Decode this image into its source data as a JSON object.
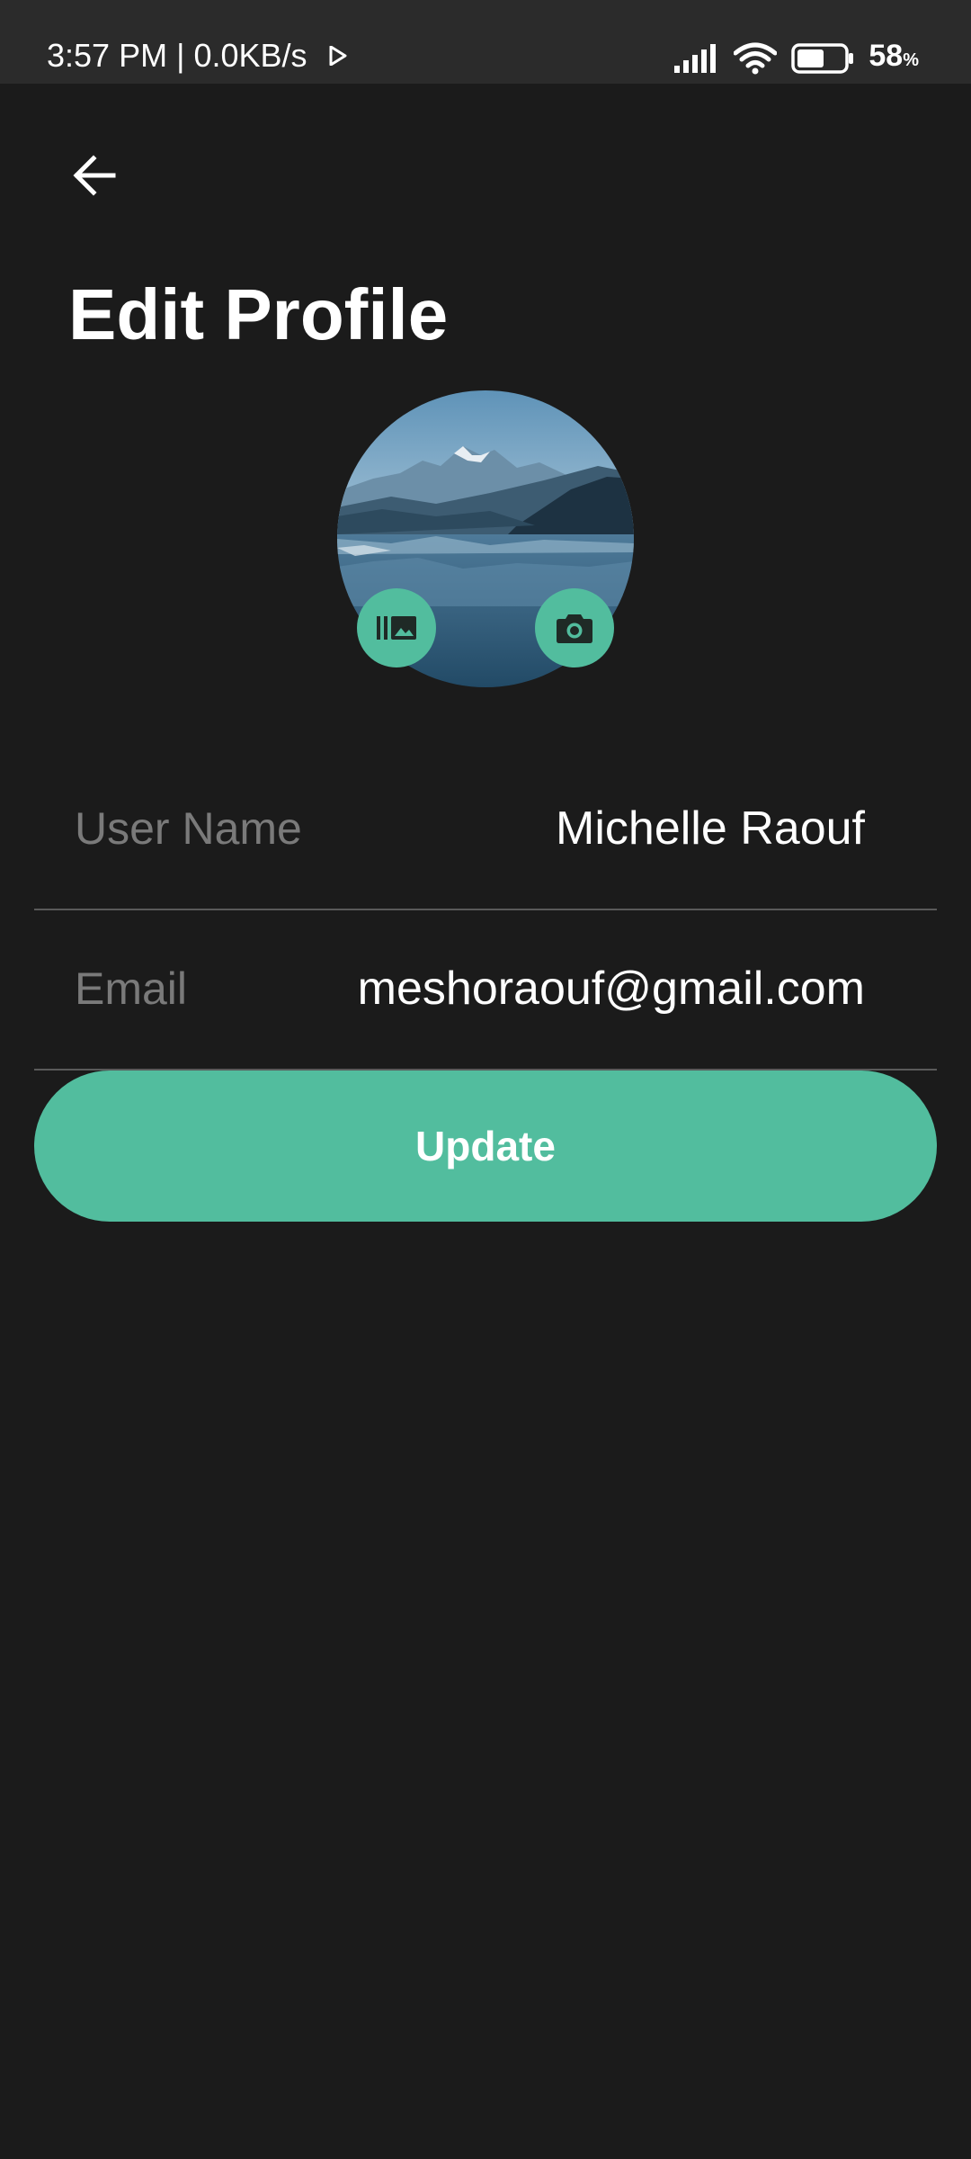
{
  "status_bar": {
    "time": "3:57 PM",
    "separator": "|",
    "network_speed": "0.0KB/s",
    "battery_percent": "58",
    "battery_unit": "%",
    "battery_level": 0.58
  },
  "header": {
    "title": "Edit Profile"
  },
  "avatar": {
    "gallery_icon": "gallery-icon",
    "camera_icon": "camera-icon"
  },
  "fields": {
    "username": {
      "label": "User Name",
      "value": "Michelle Raouf"
    },
    "email": {
      "label": "Email",
      "value": "meshoraouf@gmail.com"
    }
  },
  "actions": {
    "update_label": "Update"
  },
  "colors": {
    "background": "#1b1b1b",
    "status_bar": "#2b2b2b",
    "accent": "#52bd9e",
    "label": "#7a7a7a",
    "divider": "#5a5a5a"
  }
}
